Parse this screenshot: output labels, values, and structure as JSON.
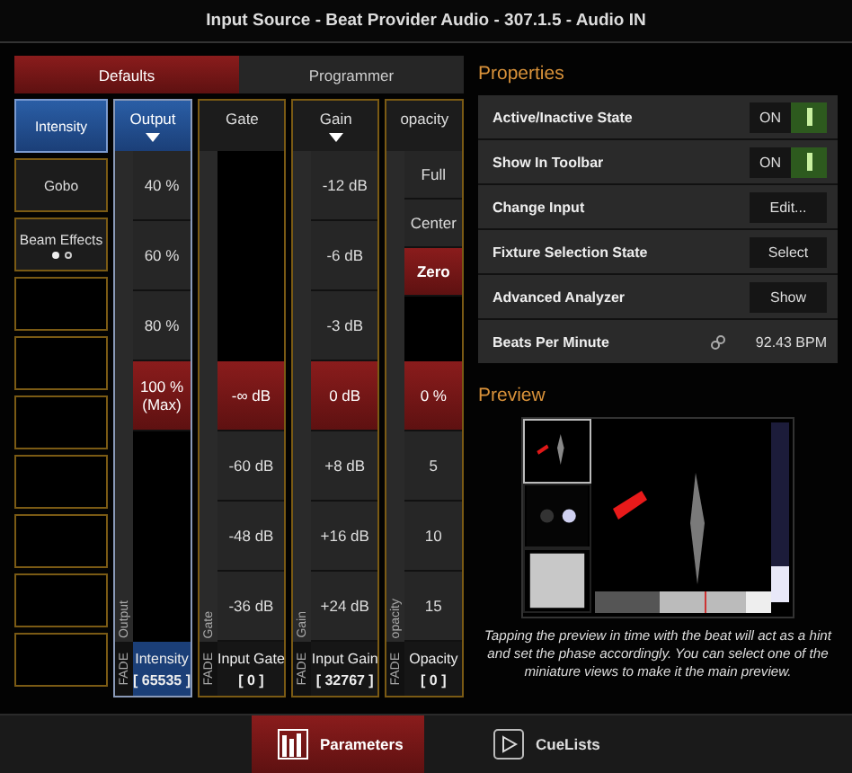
{
  "window": {
    "title": "Input Source - Beat Provider Audio - 307.1.5 - Audio IN"
  },
  "tabs": [
    {
      "label": "Defaults",
      "selected": true
    },
    {
      "label": "Programmer",
      "selected": false
    }
  ],
  "families": [
    {
      "kind": "family",
      "label": "Intensity",
      "selected": true
    },
    {
      "kind": "family",
      "label": "Gobo",
      "selected": false
    },
    {
      "kind": "family",
      "label": "Beam Effects",
      "selected": false,
      "page_dots": [
        {
          "selected": true
        },
        {
          "selected": false
        }
      ]
    },
    {
      "kind": "empty",
      "selected": false
    },
    {
      "kind": "empty",
      "selected": false
    },
    {
      "kind": "empty",
      "selected": false
    },
    {
      "kind": "empty",
      "selected": false
    },
    {
      "kind": "empty",
      "selected": false
    },
    {
      "kind": "empty",
      "selected": false
    },
    {
      "kind": "empty",
      "selected": false
    }
  ],
  "columns": [
    {
      "label": "Output",
      "selected": true,
      "dropdown": true,
      "fader_label": "Output",
      "cells": [
        {
          "kind": "value",
          "text": "40 %",
          "selected": false
        },
        {
          "kind": "value",
          "text": "60 %",
          "selected": false
        },
        {
          "kind": "value",
          "text": "80 %",
          "selected": false
        },
        {
          "kind": "value",
          "text": "100 %",
          "sub": "(Max)",
          "selected": true
        },
        {
          "kind": "empty"
        }
      ],
      "footer": {
        "fade": "FADE",
        "name": "Intensity",
        "value": "[ 65535 ]"
      }
    },
    {
      "label": "Gate",
      "selected": false,
      "dropdown": false,
      "fader_label": "Gate",
      "cells": [
        {
          "kind": "empty"
        },
        {
          "kind": "value",
          "text": "-∞ dB",
          "selected": true
        },
        {
          "kind": "value",
          "text": "-60 dB",
          "selected": false
        },
        {
          "kind": "value",
          "text": "-48 dB",
          "selected": false
        },
        {
          "kind": "value",
          "text": "-36 dB",
          "selected": false
        }
      ],
      "footer": {
        "fade": "FADE",
        "name": "Input Gate",
        "value": "[ 0 ]"
      }
    },
    {
      "label": "Gain",
      "selected": false,
      "dropdown": true,
      "fader_label": "Gain",
      "cells": [
        {
          "kind": "value",
          "text": "-12 dB",
          "selected": false
        },
        {
          "kind": "value",
          "text": "-6 dB",
          "selected": false
        },
        {
          "kind": "value",
          "text": "-3 dB",
          "selected": false
        },
        {
          "kind": "value",
          "text": "0 dB",
          "selected": true
        },
        {
          "kind": "value",
          "text": "+8 dB",
          "selected": false
        },
        {
          "kind": "value",
          "text": "+16 dB",
          "selected": false
        },
        {
          "kind": "value",
          "text": "+24 dB",
          "selected": false
        }
      ],
      "footer": {
        "fade": "FADE",
        "name": "Input Gain",
        "value": "[ 32767 ]"
      }
    },
    {
      "label": "opacity",
      "selected": false,
      "dropdown": false,
      "fader_label": "opacity",
      "cells": [
        {
          "kind": "preset",
          "text": "Full",
          "selected": false
        },
        {
          "kind": "preset",
          "text": "Center",
          "selected": false
        },
        {
          "kind": "preset",
          "text": "Zero",
          "selected": true
        },
        {
          "kind": "empty"
        },
        {
          "kind": "value",
          "text": "0 %",
          "selected": true
        },
        {
          "kind": "value",
          "text": "5",
          "selected": false
        },
        {
          "kind": "value",
          "text": "10",
          "selected": false
        },
        {
          "kind": "value",
          "text": "15",
          "selected": false
        }
      ],
      "footer": {
        "fade": "FADE",
        "name": "Opacity",
        "value": "[ 0 ]"
      }
    }
  ],
  "properties": {
    "title": "Properties",
    "rows": [
      {
        "kind": "toggle",
        "label": "Active/Inactive State",
        "value": "ON",
        "on": true
      },
      {
        "kind": "toggle",
        "label": "Show In Toolbar",
        "value": "ON",
        "on": true
      },
      {
        "kind": "button",
        "label": "Change Input",
        "button": "Edit..."
      },
      {
        "kind": "button",
        "label": "Fixture Selection State",
        "button": "Select"
      },
      {
        "kind": "button",
        "label": "Advanced Analyzer",
        "button": "Show"
      },
      {
        "kind": "reading",
        "label": "Beats Per Minute",
        "value": "92.43 BPM"
      }
    ]
  },
  "preview": {
    "title": "Preview",
    "thumbnails": [
      {
        "selected": true
      },
      {
        "selected": false
      },
      {
        "selected": false
      }
    ],
    "caption": "Tapping the preview in time with the beat will act as a hint and set the phase accordingly. You can select one of the miniature views to make it the main preview."
  },
  "bottom_tabs": [
    {
      "kind": "parameters",
      "label": "Parameters",
      "selected": true
    },
    {
      "kind": "cuelists",
      "label": "CueLists",
      "selected": false
    }
  ]
}
